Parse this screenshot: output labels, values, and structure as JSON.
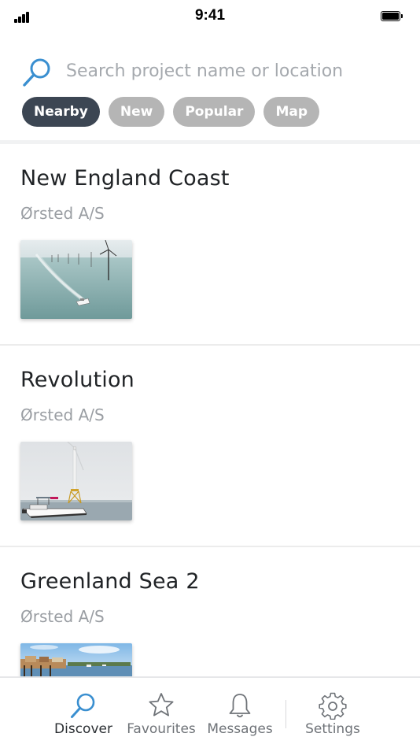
{
  "status_bar": {
    "time": "9:41",
    "signal_icon": "cellular-signal-icon",
    "battery_icon": "battery-full-icon"
  },
  "search": {
    "placeholder": "Search project name or location",
    "value": "",
    "icon": "search-icon",
    "accent_color": "#3a8fd0"
  },
  "filters": [
    {
      "label": "Nearby",
      "active": true
    },
    {
      "label": "New",
      "active": false
    },
    {
      "label": "Popular",
      "active": false
    },
    {
      "label": "Map",
      "active": false
    }
  ],
  "colors": {
    "chip_active": "#3c4653",
    "chip_inactive": "#b5b5b5",
    "accent": "#3a8fd0"
  },
  "projects": [
    {
      "title": "New England Coast",
      "owner": "Ørsted A/S",
      "image": "offshore-wind-farm-boat-photo"
    },
    {
      "title": "Revolution",
      "owner": "Ørsted A/S",
      "image": "wind-turbine-foundation-boat-photo"
    },
    {
      "title": "Greenland Sea 2",
      "owner": "Ørsted A/S",
      "image": "coastal-town-photo"
    }
  ],
  "tab_bar": {
    "tabs": [
      {
        "label": "Discover",
        "icon": "search-icon",
        "active": true
      },
      {
        "label": "Favourites",
        "icon": "star-icon",
        "active": false
      },
      {
        "label": "Messages",
        "icon": "bell-icon",
        "active": false
      },
      {
        "label": "Settings",
        "icon": "gear-icon",
        "active": false
      }
    ]
  }
}
